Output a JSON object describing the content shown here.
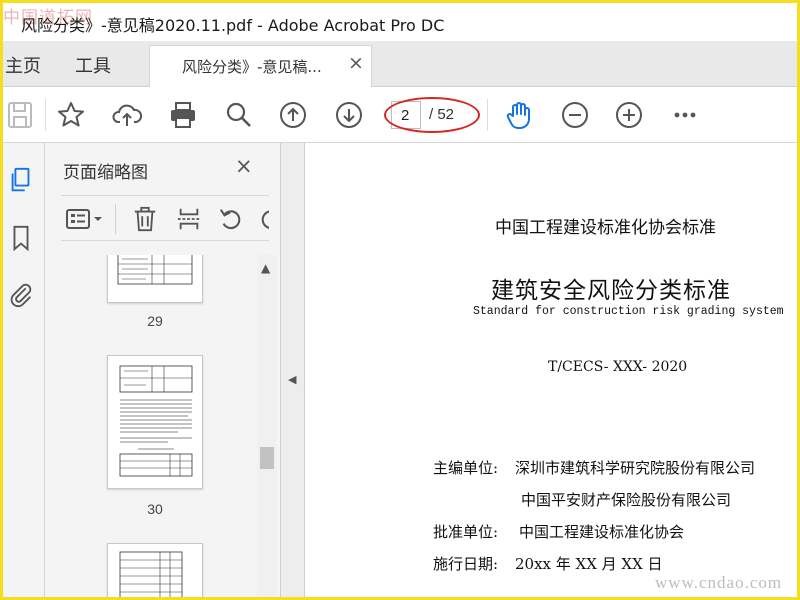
{
  "window": {
    "title": "风险分类》-意见稿2020.11.pdf - Adobe Acrobat Pro DC",
    "watermark_logo": "中国道拓网"
  },
  "tabs": {
    "home": "主页",
    "tools": "工具",
    "document": "风险分类》-意见稿...",
    "close": "×"
  },
  "toolbar": {
    "current_page": "2",
    "total_pages": "/ 52",
    "icons": [
      "save-icon",
      "star-icon",
      "cloud-upload-icon",
      "print-icon",
      "search-icon",
      "page-up-icon",
      "page-down-icon",
      "hand-tool-icon",
      "zoom-out-icon",
      "zoom-in-icon",
      "more-icon"
    ],
    "accent": "#1473e6",
    "highlight": "#d6261f"
  },
  "sidebar": {
    "icons": [
      "page-thumbnails-icon",
      "bookmark-icon",
      "attachment-icon"
    ]
  },
  "thumbnail_panel": {
    "title": "页面缩略图",
    "close": "×",
    "thumbnails": [
      {
        "label": "29"
      },
      {
        "label": "30"
      },
      {
        "label": ""
      }
    ]
  },
  "document": {
    "heading": "中国工程建设标准化协会标准",
    "title": "建筑安全风险分类标准",
    "subtitle": "Standard for construction risk grading system",
    "code": "T/CECS- XXX- 2020",
    "rows": [
      {
        "label": "主编单位:",
        "value": "深圳市建筑科学研究院股份有限公司"
      },
      {
        "label": "",
        "value": "中国平安财产保险股份有限公司"
      },
      {
        "label": "批准单位:",
        "value": "中国工程建设标准化协会"
      },
      {
        "label": "施行日期:",
        "value": "20xx 年 XX 月 XX 日"
      }
    ]
  },
  "watermark": "www.cndao.com"
}
